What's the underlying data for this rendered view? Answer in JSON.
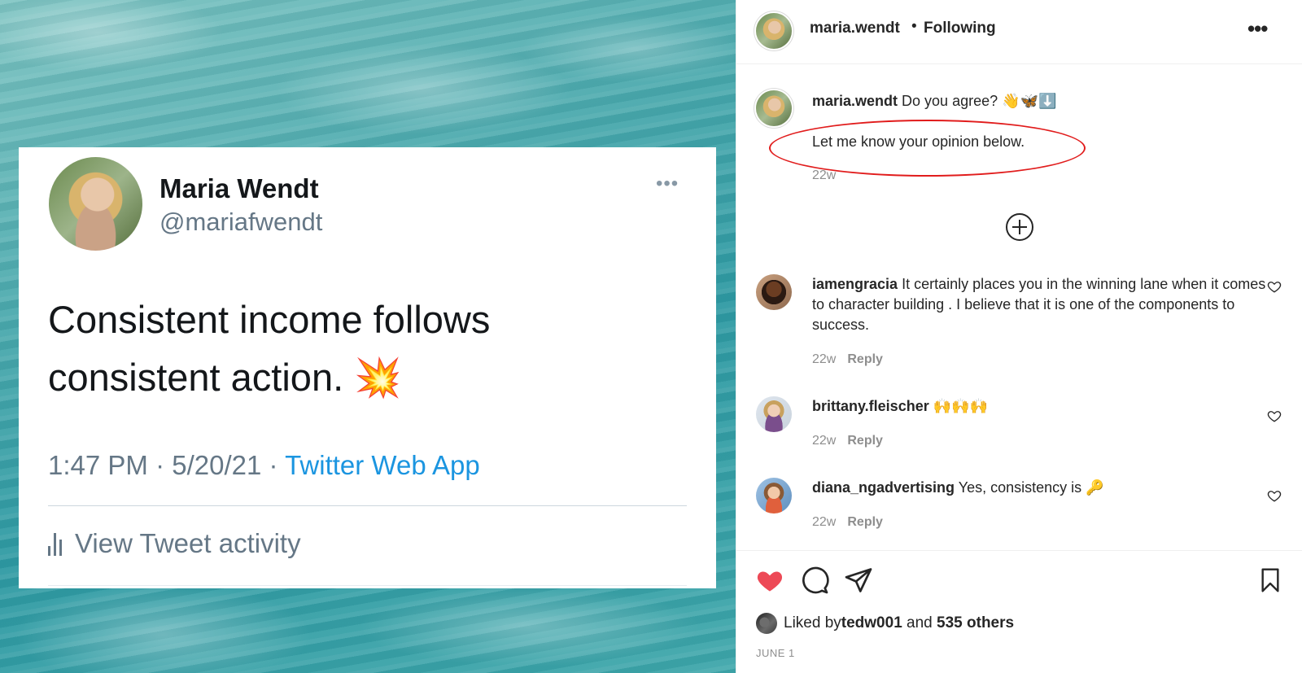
{
  "tweet": {
    "name": "Maria Wendt",
    "handle": "@mariafwendt",
    "more": "•••",
    "text": "Consistent income follows consistent action. 💥",
    "time": "1:47 PM · 5/20/21 · ",
    "app": "Twitter Web App",
    "activity": "View Tweet activity"
  },
  "header": {
    "username": "maria.wendt",
    "separator": "•",
    "follow_status": "Following",
    "more": "•••"
  },
  "caption": {
    "username": "maria.wendt",
    "line1": " Do you agree? 👋🦋⬇️",
    "line2": "Let me know your opinion below.",
    "time": "22w"
  },
  "comments": [
    {
      "username": "iamengracia",
      "text": " It certainly places you in the winning lane when it comes to character building . I believe that it is one of the components to success.",
      "time": "22w",
      "reply": "Reply"
    },
    {
      "username": "brittany.fleischer",
      "text": " 🙌🙌🙌",
      "time": "22w",
      "reply": "Reply"
    },
    {
      "username": "diana_ngadvertising",
      "text": " Yes, consistency is 🔑",
      "time": "22w",
      "reply": "Reply"
    }
  ],
  "likes": {
    "prefix": "Liked by ",
    "user": "tedw001",
    "middle": " and ",
    "others": "535 others"
  },
  "date": "JUNE 1",
  "colors": {
    "like_red": "#ed4956",
    "link_blue": "#1b95e0",
    "highlight_red": "#e11c1c"
  },
  "icons": [
    "heart-icon",
    "comment-icon",
    "share-icon",
    "bookmark-icon",
    "add-circle-icon",
    "more-icon",
    "bar-chart-icon"
  ]
}
